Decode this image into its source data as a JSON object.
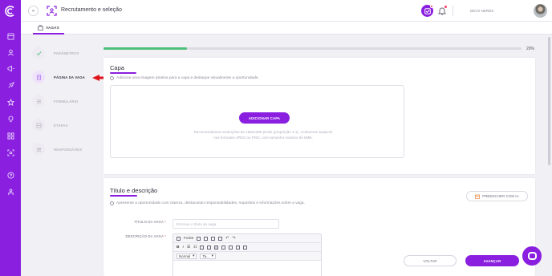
{
  "app": {
    "title": "Recrutamento e seleção"
  },
  "colors": {
    "brand": "#8a1fe0",
    "success": "#4ec07b",
    "arrow": "#e0141b"
  },
  "rail": {
    "icons": [
      "home-icon",
      "user-icon",
      "rocket-icon",
      "star-icon",
      "lightbulb-icon",
      "grid-icon",
      "target-icon",
      "help-icon",
      "people-icon"
    ]
  },
  "header": {
    "user_name": "DEVS NERDS"
  },
  "tabs": [
    {
      "label": "VAGAS"
    }
  ],
  "steps": [
    {
      "label": "PARÂMETROS",
      "state": "done",
      "icon": "check-icon"
    },
    {
      "label": "PÁGINA DA VAGA",
      "state": "active",
      "icon": "document-icon"
    },
    {
      "label": "FORMULÁRIO",
      "state": "todo",
      "icon": "list-icon"
    },
    {
      "label": "ETAPAS",
      "state": "todo",
      "icon": "stack-icon"
    },
    {
      "label": "RESPONSÁVEIS",
      "state": "todo",
      "icon": "people-icon"
    }
  ],
  "progress": {
    "percent": 20,
    "label": "20%"
  },
  "cover": {
    "title": "Capa",
    "hint": "Adicione uma imagem atrativa para a capa e destaque visualmente a oportunidade.",
    "button": "ADICIONAR CAPA",
    "recommendations": "Recomendamos resoluções de 1584x396 pixels (proporção 4:1). Aceitamos arquivos nos formatos JPEG ou PNG, com tamanho máximo de 8MB."
  },
  "details": {
    "title": "Título e descrição",
    "hint": "Apresente a oportunidade com clareza, destacando responsabilidades, requisitos e informações sobre a vaga.",
    "ai_button": "PREENCHER COM IA",
    "job_title_label": "TÍTULO DA VAGA",
    "job_title_placeholder": "Escreva o título da vaga",
    "description_label": "DESCRIÇÃO DA VAGA",
    "required_mark": "*",
    "editor": {
      "source_label": "Fonte",
      "format_select": "Normal",
      "size_select": "Ta..."
    }
  },
  "footer": {
    "back_label": "VOLTAR",
    "next_label": "AVANÇAR"
  }
}
